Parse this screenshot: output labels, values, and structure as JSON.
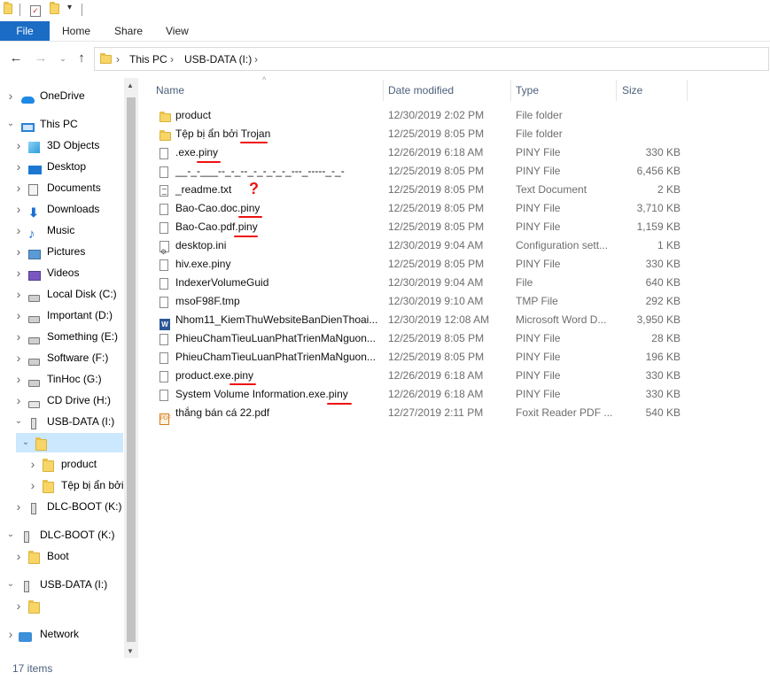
{
  "ribbon": {
    "tabs": [
      "File",
      "Home",
      "Share",
      "View"
    ]
  },
  "address": {
    "crumbs": [
      "This PC",
      "USB-DATA (I:)"
    ]
  },
  "sidebar": {
    "items": [
      {
        "label": "OneDrive",
        "icon": "cloud-icon"
      },
      {
        "label": "This PC",
        "icon": "computer-icon"
      },
      {
        "label": "3D Objects",
        "icon": "cube-icon"
      },
      {
        "label": "Desktop",
        "icon": "desktop-icon"
      },
      {
        "label": "Documents",
        "icon": "documents-icon"
      },
      {
        "label": "Downloads",
        "icon": "download-arrow-icon"
      },
      {
        "label": "Music",
        "icon": "music-note-icon"
      },
      {
        "label": "Pictures",
        "icon": "pictures-icon"
      },
      {
        "label": "Videos",
        "icon": "videos-icon"
      },
      {
        "label": "Local Disk (C:)",
        "icon": "drive-icon"
      },
      {
        "label": "Important (D:)",
        "icon": "drive-icon"
      },
      {
        "label": "Something (E:)",
        "icon": "drive-icon"
      },
      {
        "label": "Software (F:)",
        "icon": "drive-icon"
      },
      {
        "label": "TinHoc (G:)",
        "icon": "drive-icon"
      },
      {
        "label": "CD Drive (H:)",
        "icon": "cd-drive-icon"
      },
      {
        "label": "USB-DATA (I:)",
        "icon": "usb-drive-icon"
      },
      {
        "label": "",
        "icon": "folder-icon"
      },
      {
        "label": "product",
        "icon": "folder-icon"
      },
      {
        "label": "Tệp bị ẩn bởi",
        "icon": "folder-icon"
      },
      {
        "label": "DLC-BOOT (K:)",
        "icon": "usb-drive-icon"
      },
      {
        "label": "DLC-BOOT (K:)",
        "icon": "usb-drive-icon"
      },
      {
        "label": "Boot",
        "icon": "folder-icon"
      },
      {
        "label": "USB-DATA (I:)",
        "icon": "usb-drive-icon"
      },
      {
        "label": "",
        "icon": "folder-icon"
      },
      {
        "label": "Network",
        "icon": "network-icon"
      }
    ]
  },
  "columns": {
    "name": "Name",
    "date": "Date modified",
    "type": "Type",
    "size": "Size"
  },
  "files": [
    {
      "name": "product",
      "date": "12/30/2019 2:02 PM",
      "type": "File folder",
      "size": "",
      "icon": "folder-icon"
    },
    {
      "name": "Tệp bị ẩn bởi Trojan",
      "date": "12/25/2019 8:05 PM",
      "type": "File folder",
      "size": "",
      "icon": "folder-icon"
    },
    {
      "name": ".exe.piny",
      "date": "12/26/2019 6:18 AM",
      "type": "PINY File",
      "size": "330 KB",
      "icon": "file-icon"
    },
    {
      "name": "__-_-___--_-_--_-_-_-_-_---_-----_-_-",
      "date": "12/25/2019 8:05 PM",
      "type": "PINY File",
      "size": "6,456 KB",
      "icon": "file-icon"
    },
    {
      "name": "_readme.txt",
      "date": "12/25/2019 8:05 PM",
      "type": "Text Document",
      "size": "2 KB",
      "icon": "text-file-icon"
    },
    {
      "name": "Bao-Cao.doc.piny",
      "date": "12/25/2019 8:05 PM",
      "type": "PINY File",
      "size": "3,710 KB",
      "icon": "file-icon"
    },
    {
      "name": "Bao-Cao.pdf.piny",
      "date": "12/25/2019 8:05 PM",
      "type": "PINY File",
      "size": "1,159 KB",
      "icon": "file-icon"
    },
    {
      "name": "desktop.ini",
      "date": "12/30/2019 9:04 AM",
      "type": "Configuration sett...",
      "size": "1 KB",
      "icon": "settings-file-icon"
    },
    {
      "name": "hiv.exe.piny",
      "date": "12/25/2019 8:05 PM",
      "type": "PINY File",
      "size": "330 KB",
      "icon": "file-icon"
    },
    {
      "name": "IndexerVolumeGuid",
      "date": "12/30/2019 9:04 AM",
      "type": "File",
      "size": "640 KB",
      "icon": "file-icon"
    },
    {
      "name": "msoF98F.tmp",
      "date": "12/30/2019 9:10 AM",
      "type": "TMP File",
      "size": "292 KB",
      "icon": "file-icon"
    },
    {
      "name": "Nhom11_KiemThuWebsiteBanDienThoai...",
      "date": "12/30/2019 12:08 AM",
      "type": "Microsoft Word D...",
      "size": "3,950 KB",
      "icon": "word-doc-icon"
    },
    {
      "name": "PhieuChamTieuLuanPhatTrienMaNguon...",
      "date": "12/25/2019 8:05 PM",
      "type": "PINY File",
      "size": "28 KB",
      "icon": "file-icon"
    },
    {
      "name": "PhieuChamTieuLuanPhatTrienMaNguon...",
      "date": "12/25/2019 8:05 PM",
      "type": "PINY File",
      "size": "196 KB",
      "icon": "file-icon"
    },
    {
      "name": "product.exe.piny",
      "date": "12/26/2019 6:18 AM",
      "type": "PINY File",
      "size": "330 KB",
      "icon": "file-icon"
    },
    {
      "name": "System Volume Information.exe.piny",
      "date": "12/26/2019 6:18 AM",
      "type": "PINY File",
      "size": "330 KB",
      "icon": "file-icon"
    },
    {
      "name": "thắng bán cá 22.pdf",
      "date": "12/27/2019 2:11 PM",
      "type": "Foxit Reader PDF ...",
      "size": "540 KB",
      "icon": "pdf-file-icon"
    }
  ],
  "annotation": {
    "question_mark": "?"
  },
  "status": {
    "count": "17 items"
  }
}
